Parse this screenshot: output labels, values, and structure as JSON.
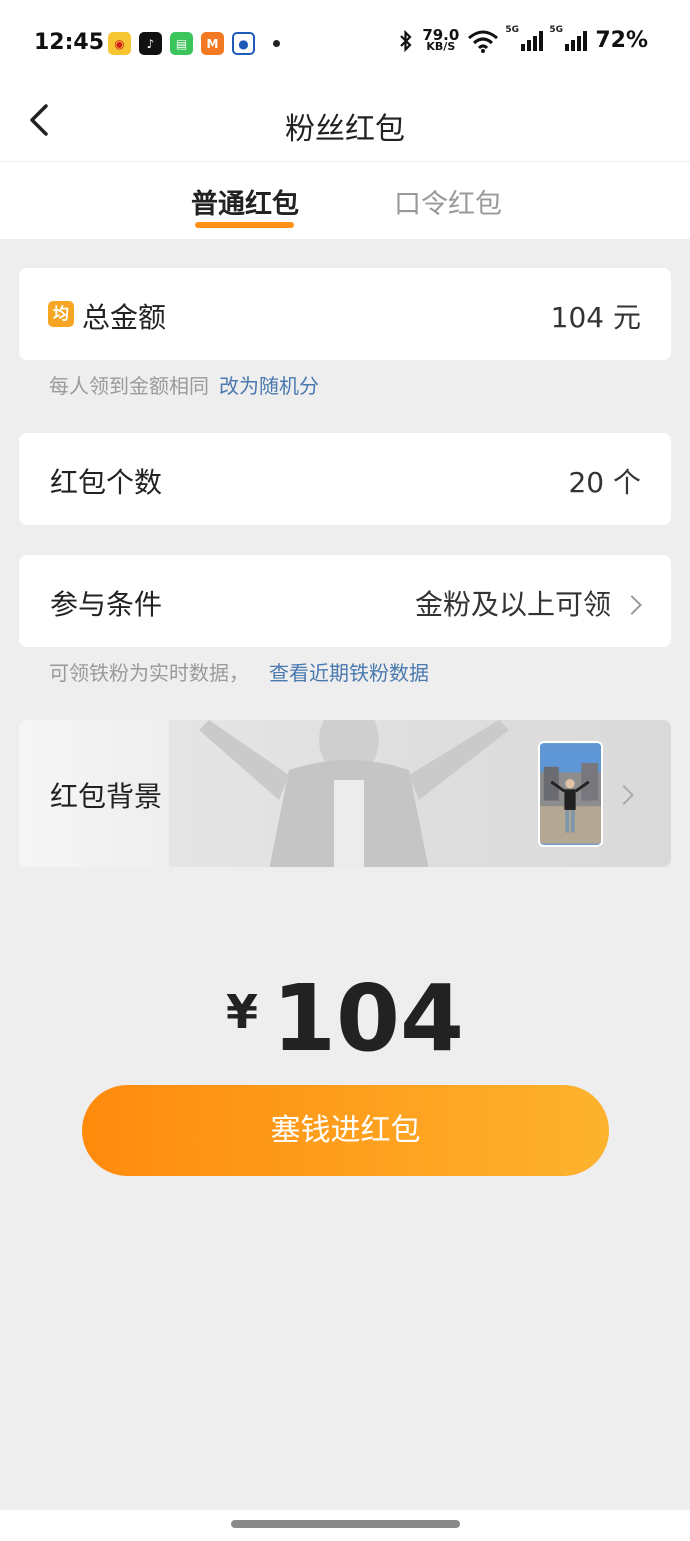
{
  "status_bar": {
    "time": "12:45",
    "net_speed_value": "79.0",
    "net_speed_unit": "KB/S",
    "signal_tag": "5G",
    "battery": "72%",
    "app_icons": [
      "weibo-icon",
      "tiktok-icon",
      "green-app-icon",
      "orange-app-icon",
      "blue-app-icon"
    ]
  },
  "nav": {
    "title": "粉丝红包"
  },
  "tabs": {
    "normal": "普通红包",
    "password": "口令红包"
  },
  "total_amount": {
    "badge": "均",
    "label": "总金额",
    "value": "104 元"
  },
  "amount_hint": {
    "text": "每人领到金额相同",
    "link": "改为随机分"
  },
  "count": {
    "label": "红包个数",
    "value": "20 个"
  },
  "condition": {
    "label": "参与条件",
    "value": "金粉及以上可领"
  },
  "condition_hint": {
    "text": "可领铁粉为实时数据，",
    "link": "查看近期铁粉数据"
  },
  "background": {
    "label": "红包背景"
  },
  "summary": {
    "currency": "¥",
    "amount": "104"
  },
  "submit_button": "塞钱进红包",
  "colors": {
    "accent": "#ff9216",
    "link": "#4a79b0",
    "button_start": "#ff8a0c",
    "button_end": "#fdb32e"
  }
}
